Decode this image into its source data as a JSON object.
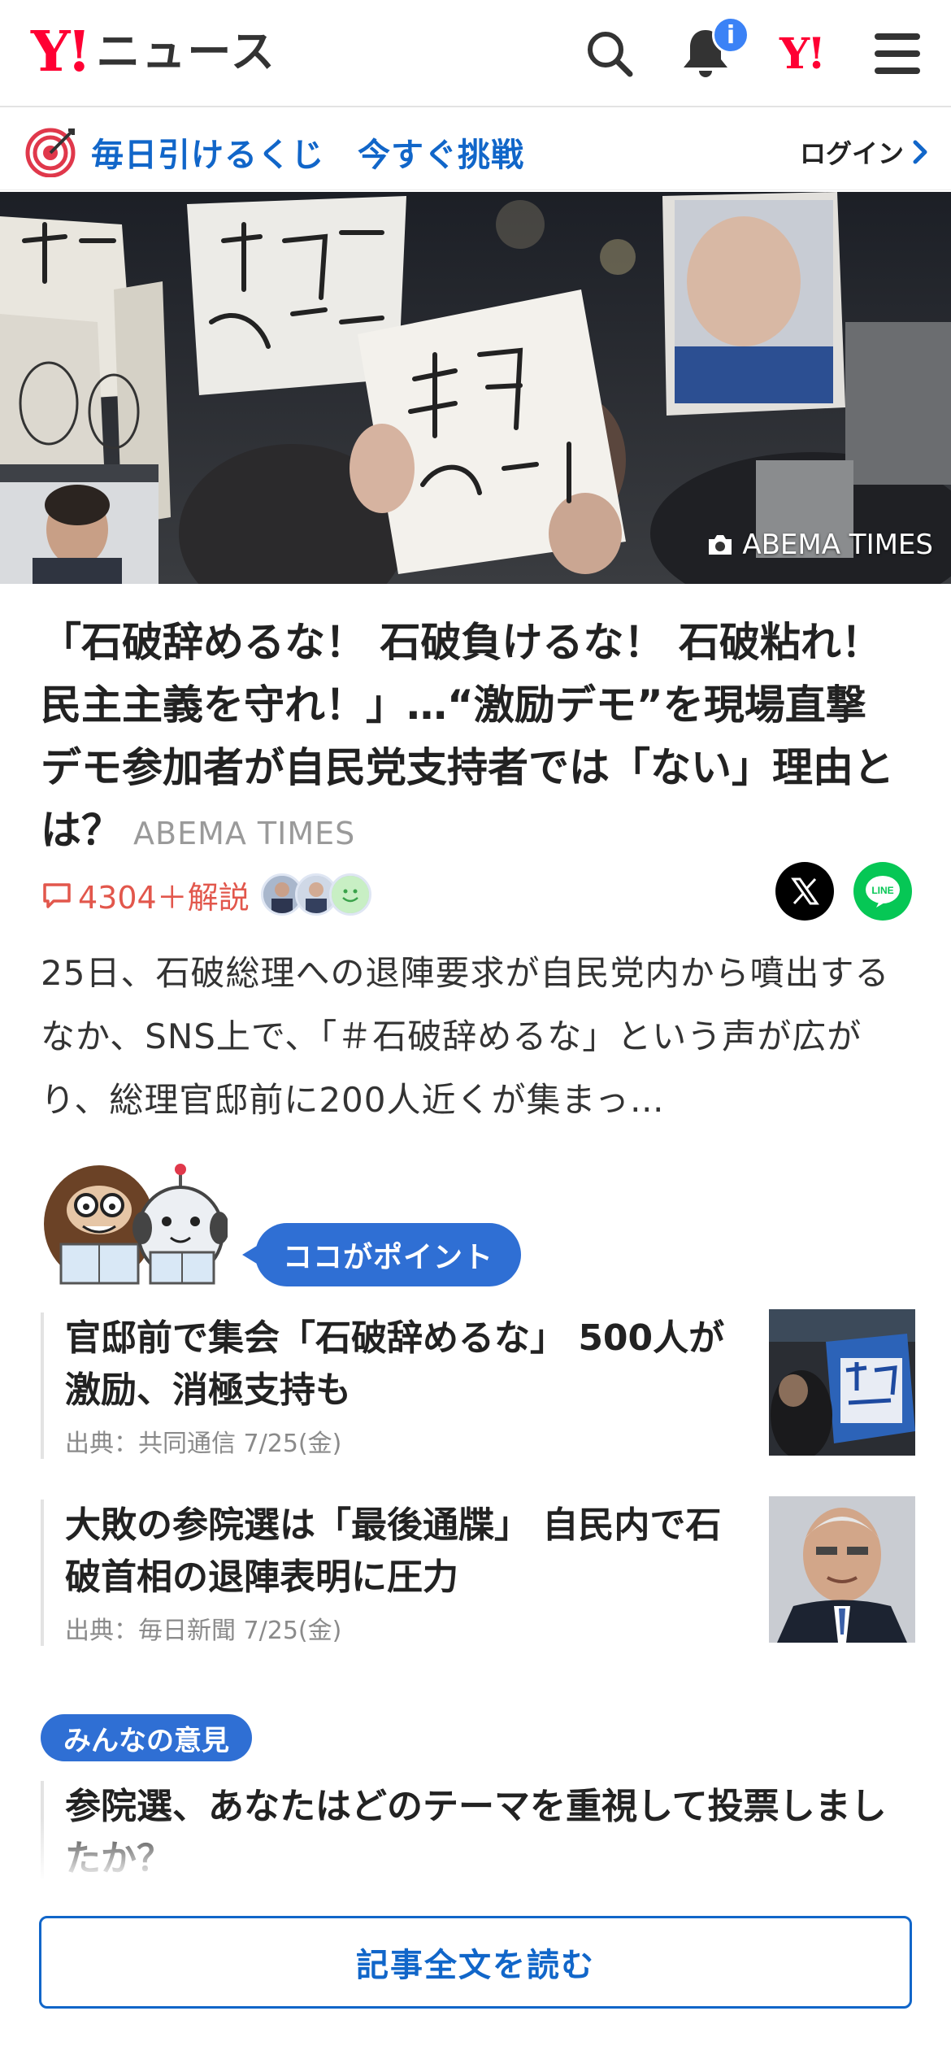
{
  "header": {
    "logo_mark": "Y!",
    "logo_text": "ニュース",
    "notification_badge": "i",
    "yahoo_mark": "Y!",
    "icons": [
      "search-icon",
      "bell-icon",
      "yahoo-logo",
      "hamburger-menu-icon"
    ]
  },
  "promo": {
    "text": "毎日引けるくじ　今すぐ挑戦",
    "login": "ログイン"
  },
  "hero": {
    "credit": "ABEMA TIMES"
  },
  "article": {
    "headline": "「石破辞めるな！ 石破負けるな！ 石破粘れ！ 民主主義を守れ！」…“激励デモ”を現場直撃 デモ参加者が自民党支持者では「ない」理由とは？",
    "source": "ABEMA TIMES",
    "comment_count": "4304＋解説",
    "summary": "25日、石破総理への退陣要求が自民党内から噴出するなか、SNS上で、「＃石破辞めるな」という声が広がり、総理官邸前に200人近くが集まっ…"
  },
  "point": {
    "label": "ココがポイント",
    "items": [
      {
        "title": "官邸前で集会「石破辞めるな」 500人が激励、消極支持も",
        "source": "出典：共同通信 7/25(金)"
      },
      {
        "title": "大敗の参院選は「最後通牒」 自民内で石破首相の退陣表明に圧力",
        "source": "出典：毎日新聞 7/25(金)"
      }
    ]
  },
  "opinion": {
    "badge": "みんなの意見",
    "question": "参院選、あなたはどのテーマを重視して投票しましたか？"
  },
  "cta": {
    "read_full": "記事全文を読む"
  },
  "colors": {
    "brand_red": "#ff0033",
    "link_blue": "#1166c9",
    "badge_blue": "#2f6fd4",
    "comment_red": "#e2574c",
    "line_green": "#06c755"
  }
}
